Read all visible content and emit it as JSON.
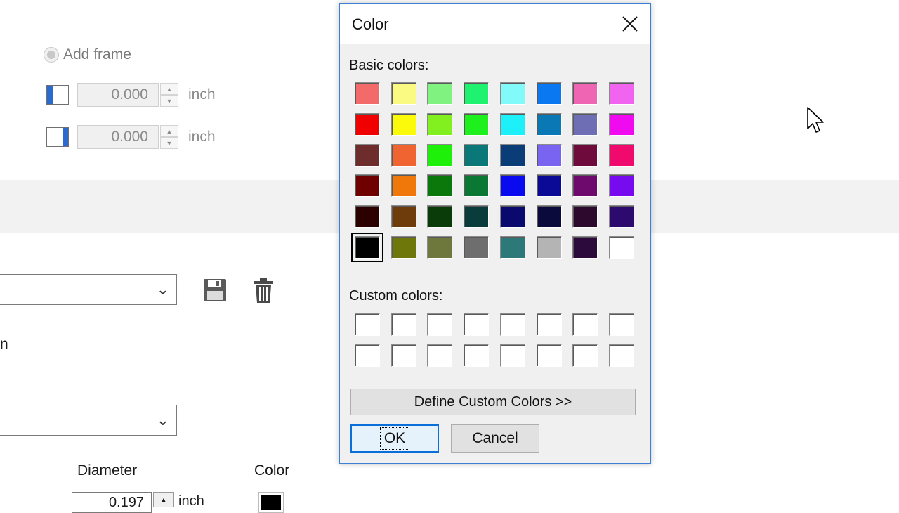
{
  "background": {
    "add_frame_label": "Add frame",
    "spin1_value": "0.000",
    "spin2_value": "0.000",
    "unit": "inch",
    "cut_text": "n",
    "diameter_label": "Diameter",
    "color_label": "Color",
    "diameter_value": "0.197",
    "diameter_unit": "inch"
  },
  "dialog": {
    "title": "Color",
    "basic_label": "Basic colors:",
    "custom_label": "Custom colors:",
    "define_button": "Define Custom Colors >>",
    "ok_button": "OK",
    "cancel_button": "Cancel",
    "selected_color": "#000000",
    "basic_colors": [
      [
        "#f26a6a",
        "#fafa82",
        "#80f280",
        "#1ef26e",
        "#82fafa",
        "#0a78f0",
        "#f064b4",
        "#f064f0"
      ],
      [
        "#f00000",
        "#fafa0a",
        "#82f01e",
        "#1ef01e",
        "#1ef0fa",
        "#0a78b4",
        "#6e6eb4",
        "#f00af0"
      ],
      [
        "#6e2d2d",
        "#f06432",
        "#1ef00a",
        "#0a7878",
        "#0a3c78",
        "#7864f0",
        "#6e0a3c",
        "#f00a6e"
      ],
      [
        "#6e0000",
        "#f0780a",
        "#0a780a",
        "#0a7832",
        "#0a0af0",
        "#0a0a96",
        "#6e0a6e",
        "#780af0"
      ],
      [
        "#2d0000",
        "#6e3c0a",
        "#0a3c0a",
        "#0a3c3c",
        "#0a0a6e",
        "#0a0a3c",
        "#2d0a2d",
        "#2d0a6e"
      ],
      [
        "#000000",
        "#6e780a",
        "#6e783c",
        "#6e6e6e",
        "#2d7878",
        "#b4b4b4",
        "#2d0a3c",
        "#ffffff"
      ]
    ]
  }
}
